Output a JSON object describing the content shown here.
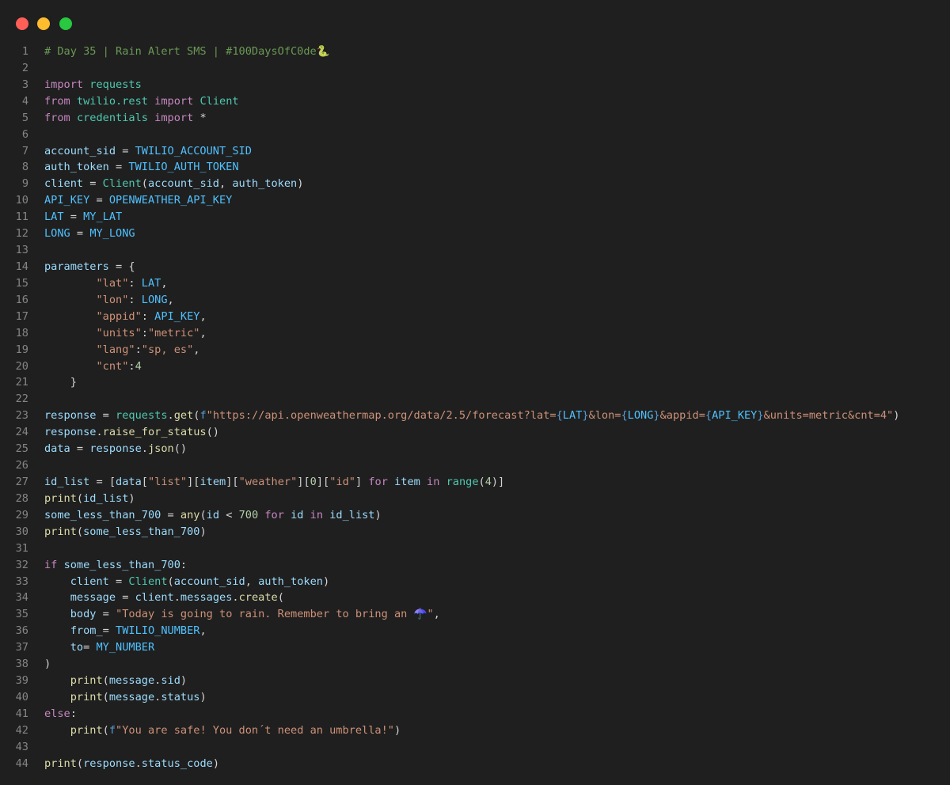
{
  "window": {
    "controls": {
      "close_color": "#ff5f57",
      "minimize_color": "#febc2e",
      "maximize_color": "#28c840"
    }
  },
  "editor": {
    "language": "python",
    "theme_background": "#1f1f1f",
    "lines": [
      {
        "n": "1",
        "tokens": [
          {
            "t": "# Day 35 | Rain Alert SMS | #100DaysOfC0de🐍",
            "c": "cmt"
          }
        ]
      },
      {
        "n": "2",
        "tokens": []
      },
      {
        "n": "3",
        "tokens": [
          {
            "t": "import",
            "c": "kw"
          },
          {
            "t": " "
          },
          {
            "t": "requests",
            "c": "mod"
          }
        ]
      },
      {
        "n": "4",
        "tokens": [
          {
            "t": "from",
            "c": "kw"
          },
          {
            "t": " "
          },
          {
            "t": "twilio.rest",
            "c": "mod"
          },
          {
            "t": " "
          },
          {
            "t": "import",
            "c": "kw"
          },
          {
            "t": " "
          },
          {
            "t": "Client",
            "c": "mod"
          }
        ]
      },
      {
        "n": "5",
        "tokens": [
          {
            "t": "from",
            "c": "kw"
          },
          {
            "t": " "
          },
          {
            "t": "credentials",
            "c": "mod"
          },
          {
            "t": " "
          },
          {
            "t": "import",
            "c": "kw"
          },
          {
            "t": " *"
          }
        ]
      },
      {
        "n": "6",
        "tokens": []
      },
      {
        "n": "7",
        "tokens": [
          {
            "t": "account_sid",
            "c": "var"
          },
          {
            "t": " = "
          },
          {
            "t": "TWILIO_ACCOUNT_SID",
            "c": "const"
          }
        ]
      },
      {
        "n": "8",
        "tokens": [
          {
            "t": "auth_token",
            "c": "var"
          },
          {
            "t": " = "
          },
          {
            "t": "TWILIO_AUTH_TOKEN",
            "c": "const"
          }
        ]
      },
      {
        "n": "9",
        "tokens": [
          {
            "t": "client",
            "c": "var"
          },
          {
            "t": " = "
          },
          {
            "t": "Client",
            "c": "mod"
          },
          {
            "t": "("
          },
          {
            "t": "account_sid",
            "c": "var"
          },
          {
            "t": ", "
          },
          {
            "t": "auth_token",
            "c": "var"
          },
          {
            "t": ")"
          }
        ]
      },
      {
        "n": "10",
        "tokens": [
          {
            "t": "API_KEY",
            "c": "const"
          },
          {
            "t": " = "
          },
          {
            "t": "OPENWEATHER_API_KEY",
            "c": "const"
          }
        ]
      },
      {
        "n": "11",
        "tokens": [
          {
            "t": "LAT",
            "c": "const"
          },
          {
            "t": " = "
          },
          {
            "t": "MY_LAT",
            "c": "const"
          }
        ]
      },
      {
        "n": "12",
        "tokens": [
          {
            "t": "LONG",
            "c": "const"
          },
          {
            "t": " = "
          },
          {
            "t": "MY_LONG",
            "c": "const"
          }
        ]
      },
      {
        "n": "13",
        "tokens": []
      },
      {
        "n": "14",
        "tokens": [
          {
            "t": "parameters",
            "c": "var"
          },
          {
            "t": " = {"
          }
        ]
      },
      {
        "n": "15",
        "tokens": [
          {
            "t": "        "
          },
          {
            "t": "\"lat\"",
            "c": "str"
          },
          {
            "t": ": "
          },
          {
            "t": "LAT",
            "c": "const"
          },
          {
            "t": ","
          }
        ]
      },
      {
        "n": "16",
        "tokens": [
          {
            "t": "        "
          },
          {
            "t": "\"lon\"",
            "c": "str"
          },
          {
            "t": ": "
          },
          {
            "t": "LONG",
            "c": "const"
          },
          {
            "t": ","
          }
        ]
      },
      {
        "n": "17",
        "tokens": [
          {
            "t": "        "
          },
          {
            "t": "\"appid\"",
            "c": "str"
          },
          {
            "t": ": "
          },
          {
            "t": "API_KEY",
            "c": "const"
          },
          {
            "t": ","
          }
        ]
      },
      {
        "n": "18",
        "tokens": [
          {
            "t": "        "
          },
          {
            "t": "\"units\"",
            "c": "str"
          },
          {
            "t": ":"
          },
          {
            "t": "\"metric\"",
            "c": "str"
          },
          {
            "t": ","
          }
        ]
      },
      {
        "n": "19",
        "tokens": [
          {
            "t": "        "
          },
          {
            "t": "\"lang\"",
            "c": "str"
          },
          {
            "t": ":"
          },
          {
            "t": "\"sp, es\"",
            "c": "str"
          },
          {
            "t": ","
          }
        ]
      },
      {
        "n": "20",
        "tokens": [
          {
            "t": "        "
          },
          {
            "t": "\"cnt\"",
            "c": "str"
          },
          {
            "t": ":"
          },
          {
            "t": "4",
            "c": "num"
          }
        ]
      },
      {
        "n": "21",
        "tokens": [
          {
            "t": "    }"
          }
        ]
      },
      {
        "n": "22",
        "tokens": []
      },
      {
        "n": "23",
        "tokens": [
          {
            "t": "response",
            "c": "var"
          },
          {
            "t": " = "
          },
          {
            "t": "requests",
            "c": "mod"
          },
          {
            "t": "."
          },
          {
            "t": "get",
            "c": "fn"
          },
          {
            "t": "("
          },
          {
            "t": "f",
            "c": "blue"
          },
          {
            "t": "\"https://api.openweathermap.org/data/2.5/forecast?lat=",
            "c": "str"
          },
          {
            "t": "{",
            "c": "blue"
          },
          {
            "t": "LAT",
            "c": "const"
          },
          {
            "t": "}",
            "c": "blue"
          },
          {
            "t": "&lon=",
            "c": "str"
          },
          {
            "t": "{",
            "c": "blue"
          },
          {
            "t": "LONG",
            "c": "const"
          },
          {
            "t": "}",
            "c": "blue"
          },
          {
            "t": "&appid=",
            "c": "str"
          },
          {
            "t": "{",
            "c": "blue"
          },
          {
            "t": "API_KEY",
            "c": "const"
          },
          {
            "t": "}",
            "c": "blue"
          },
          {
            "t": "&units=metric&cnt=4\"",
            "c": "str"
          },
          {
            "t": ")"
          }
        ]
      },
      {
        "n": "24",
        "tokens": [
          {
            "t": "response",
            "c": "var"
          },
          {
            "t": "."
          },
          {
            "t": "raise_for_status",
            "c": "fn"
          },
          {
            "t": "()"
          }
        ]
      },
      {
        "n": "25",
        "tokens": [
          {
            "t": "data",
            "c": "var"
          },
          {
            "t": " = "
          },
          {
            "t": "response",
            "c": "var"
          },
          {
            "t": "."
          },
          {
            "t": "json",
            "c": "fn"
          },
          {
            "t": "()"
          }
        ]
      },
      {
        "n": "26",
        "tokens": []
      },
      {
        "n": "27",
        "tokens": [
          {
            "t": "id_list",
            "c": "var"
          },
          {
            "t": " = ["
          },
          {
            "t": "data",
            "c": "var"
          },
          {
            "t": "["
          },
          {
            "t": "\"list\"",
            "c": "str"
          },
          {
            "t": "]["
          },
          {
            "t": "item",
            "c": "var"
          },
          {
            "t": "]["
          },
          {
            "t": "\"weather\"",
            "c": "str"
          },
          {
            "t": "]["
          },
          {
            "t": "0",
            "c": "num"
          },
          {
            "t": "]["
          },
          {
            "t": "\"id\"",
            "c": "str"
          },
          {
            "t": "] "
          },
          {
            "t": "for",
            "c": "kw"
          },
          {
            "t": " "
          },
          {
            "t": "item",
            "c": "var"
          },
          {
            "t": " "
          },
          {
            "t": "in",
            "c": "kw"
          },
          {
            "t": " "
          },
          {
            "t": "range",
            "c": "bi"
          },
          {
            "t": "("
          },
          {
            "t": "4",
            "c": "num"
          },
          {
            "t": ")]"
          }
        ]
      },
      {
        "n": "28",
        "tokens": [
          {
            "t": "print",
            "c": "fn"
          },
          {
            "t": "("
          },
          {
            "t": "id_list",
            "c": "var"
          },
          {
            "t": ")"
          }
        ]
      },
      {
        "n": "29",
        "tokens": [
          {
            "t": "some_less_than_700",
            "c": "var"
          },
          {
            "t": " = "
          },
          {
            "t": "any",
            "c": "fn"
          },
          {
            "t": "("
          },
          {
            "t": "id",
            "c": "var"
          },
          {
            "t": " < "
          },
          {
            "t": "700",
            "c": "num"
          },
          {
            "t": " "
          },
          {
            "t": "for",
            "c": "kw"
          },
          {
            "t": " "
          },
          {
            "t": "id",
            "c": "var"
          },
          {
            "t": " "
          },
          {
            "t": "in",
            "c": "kw"
          },
          {
            "t": " "
          },
          {
            "t": "id_list",
            "c": "var"
          },
          {
            "t": ")"
          }
        ]
      },
      {
        "n": "30",
        "tokens": [
          {
            "t": "print",
            "c": "fn"
          },
          {
            "t": "("
          },
          {
            "t": "some_less_than_700",
            "c": "var"
          },
          {
            "t": ")"
          }
        ]
      },
      {
        "n": "31",
        "tokens": []
      },
      {
        "n": "32",
        "tokens": [
          {
            "t": "if",
            "c": "kw"
          },
          {
            "t": " "
          },
          {
            "t": "some_less_than_700",
            "c": "var"
          },
          {
            "t": ":"
          }
        ]
      },
      {
        "n": "33",
        "tokens": [
          {
            "t": "    "
          },
          {
            "t": "client",
            "c": "var"
          },
          {
            "t": " = "
          },
          {
            "t": "Client",
            "c": "mod"
          },
          {
            "t": "("
          },
          {
            "t": "account_sid",
            "c": "var"
          },
          {
            "t": ", "
          },
          {
            "t": "auth_token",
            "c": "var"
          },
          {
            "t": ")"
          }
        ]
      },
      {
        "n": "34",
        "tokens": [
          {
            "t": "    "
          },
          {
            "t": "message",
            "c": "var"
          },
          {
            "t": " = "
          },
          {
            "t": "client",
            "c": "var"
          },
          {
            "t": "."
          },
          {
            "t": "messages",
            "c": "var"
          },
          {
            "t": "."
          },
          {
            "t": "create",
            "c": "fn"
          },
          {
            "t": "("
          }
        ]
      },
      {
        "n": "35",
        "tokens": [
          {
            "t": "    "
          },
          {
            "t": "body",
            "c": "var"
          },
          {
            "t": " = "
          },
          {
            "t": "\"Today is going to rain. Remember to bring an ☂️\"",
            "c": "str"
          },
          {
            "t": ","
          }
        ]
      },
      {
        "n": "36",
        "tokens": [
          {
            "t": "    "
          },
          {
            "t": "from_",
            "c": "var"
          },
          {
            "t": "= "
          },
          {
            "t": "TWILIO_NUMBER",
            "c": "const"
          },
          {
            "t": ","
          }
        ]
      },
      {
        "n": "37",
        "tokens": [
          {
            "t": "    "
          },
          {
            "t": "to",
            "c": "var"
          },
          {
            "t": "= "
          },
          {
            "t": "MY_NUMBER",
            "c": "const"
          }
        ]
      },
      {
        "n": "38",
        "tokens": [
          {
            "t": ")"
          }
        ]
      },
      {
        "n": "39",
        "tokens": [
          {
            "t": "    "
          },
          {
            "t": "print",
            "c": "fn"
          },
          {
            "t": "("
          },
          {
            "t": "message",
            "c": "var"
          },
          {
            "t": "."
          },
          {
            "t": "sid",
            "c": "var"
          },
          {
            "t": ")"
          }
        ]
      },
      {
        "n": "40",
        "tokens": [
          {
            "t": "    "
          },
          {
            "t": "print",
            "c": "fn"
          },
          {
            "t": "("
          },
          {
            "t": "message",
            "c": "var"
          },
          {
            "t": "."
          },
          {
            "t": "status",
            "c": "var"
          },
          {
            "t": ")"
          }
        ]
      },
      {
        "n": "41",
        "tokens": [
          {
            "t": "else",
            "c": "kw"
          },
          {
            "t": ":"
          }
        ]
      },
      {
        "n": "42",
        "tokens": [
          {
            "t": "    "
          },
          {
            "t": "print",
            "c": "fn"
          },
          {
            "t": "("
          },
          {
            "t": "f",
            "c": "blue"
          },
          {
            "t": "\"You are safe! You don´t need an umbrella!\"",
            "c": "str"
          },
          {
            "t": ")"
          }
        ]
      },
      {
        "n": "43",
        "tokens": []
      },
      {
        "n": "44",
        "tokens": [
          {
            "t": "print",
            "c": "fn"
          },
          {
            "t": "("
          },
          {
            "t": "response",
            "c": "var"
          },
          {
            "t": "."
          },
          {
            "t": "status_code",
            "c": "var"
          },
          {
            "t": ")"
          }
        ]
      }
    ]
  }
}
